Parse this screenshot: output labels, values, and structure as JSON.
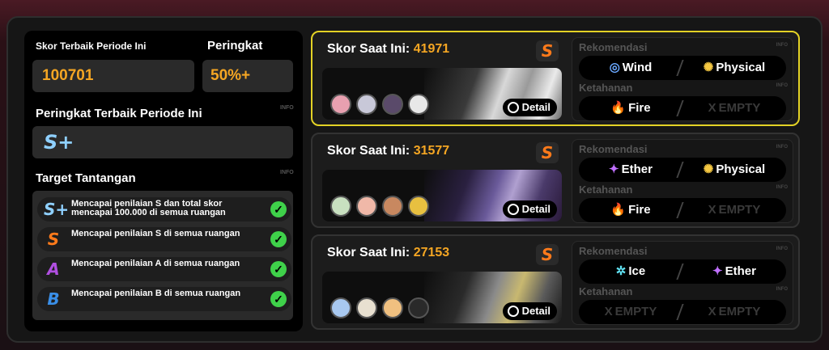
{
  "left": {
    "best_score_label": "Skor Terbaik Periode Ini",
    "best_score_value": "100701",
    "rank_label": "Peringkat",
    "rank_value": "50%+",
    "best_rank_label": "Peringkat Terbaik Periode Ini",
    "best_rank_value": "S+",
    "target_label": "Target Tantangan",
    "info_label": "INFO",
    "targets": [
      {
        "badge": "S+",
        "color": "#8fd0ff",
        "text": "Mencapai penilaian S dan total skor mencapai 100.000 di semua ruangan",
        "check": "✓"
      },
      {
        "badge": "S",
        "color": "#ff7a1a",
        "text": "Mencapai penilaian S di semua ruangan",
        "check": "✓"
      },
      {
        "badge": "A",
        "color": "#b04fe0",
        "text": "Mencapai penilaian A di semua ruangan",
        "check": "✓"
      },
      {
        "badge": "B",
        "color": "#3a8fe8",
        "text": "Mencapai penilaian B di semua ruangan",
        "check": "✓"
      }
    ]
  },
  "cards": [
    {
      "title_label": "Skor Saat Ini:",
      "score": "41971",
      "rank": "S",
      "detail": "Detail",
      "rec_label": "Rekomendasi",
      "res_label": "Ketahanan",
      "rec": [
        {
          "icon": "wind-icon",
          "glyph": "◎",
          "color": "#6aa8ff",
          "text": "Wind"
        },
        {
          "icon": "physical-icon",
          "glyph": "✺",
          "color": "#f5c842",
          "text": "Physical"
        }
      ],
      "res": [
        {
          "icon": "fire-icon",
          "glyph": "🔥",
          "color": "#ff6a2a",
          "text": "Fire"
        },
        {
          "icon": "empty-icon",
          "glyph": "X",
          "color": "#3a3a3a",
          "text": "EMPTY"
        }
      ],
      "avatars": [
        "#e8a0b0",
        "#c8c8d8",
        "#5a4a6a",
        "#e8e8e8"
      ]
    },
    {
      "title_label": "Skor Saat Ini:",
      "score": "31577",
      "rank": "S",
      "detail": "Detail",
      "rec_label": "Rekomendasi",
      "res_label": "Ketahanan",
      "rec": [
        {
          "icon": "ether-icon",
          "glyph": "✦",
          "color": "#c070ff",
          "text": "Ether"
        },
        {
          "icon": "physical-icon",
          "glyph": "✺",
          "color": "#f5c842",
          "text": "Physical"
        }
      ],
      "res": [
        {
          "icon": "fire-icon",
          "glyph": "🔥",
          "color": "#ff6a2a",
          "text": "Fire"
        },
        {
          "icon": "empty-icon",
          "glyph": "X",
          "color": "#3a3a3a",
          "text": "EMPTY"
        }
      ],
      "avatars": [
        "#c8e0c0",
        "#f0b8a8",
        "#c88860",
        "#e8c040"
      ]
    },
    {
      "title_label": "Skor Saat Ini:",
      "score": "27153",
      "rank": "S",
      "detail": "Detail",
      "rec_label": "Rekomendasi",
      "res_label": "Ketahanan",
      "rec": [
        {
          "icon": "ice-icon",
          "glyph": "✲",
          "color": "#60e0f0",
          "text": "Ice"
        },
        {
          "icon": "ether-icon",
          "glyph": "✦",
          "color": "#c070ff",
          "text": "Ether"
        }
      ],
      "res": [
        {
          "icon": "empty-icon",
          "glyph": "X",
          "color": "#3a3a3a",
          "text": "EMPTY"
        },
        {
          "icon": "empty-icon",
          "glyph": "X",
          "color": "#3a3a3a",
          "text": "EMPTY"
        }
      ],
      "avatars": [
        "#a8c8f0",
        "#e8e0d0",
        "#f0c080",
        "#2a2a2a"
      ]
    }
  ]
}
